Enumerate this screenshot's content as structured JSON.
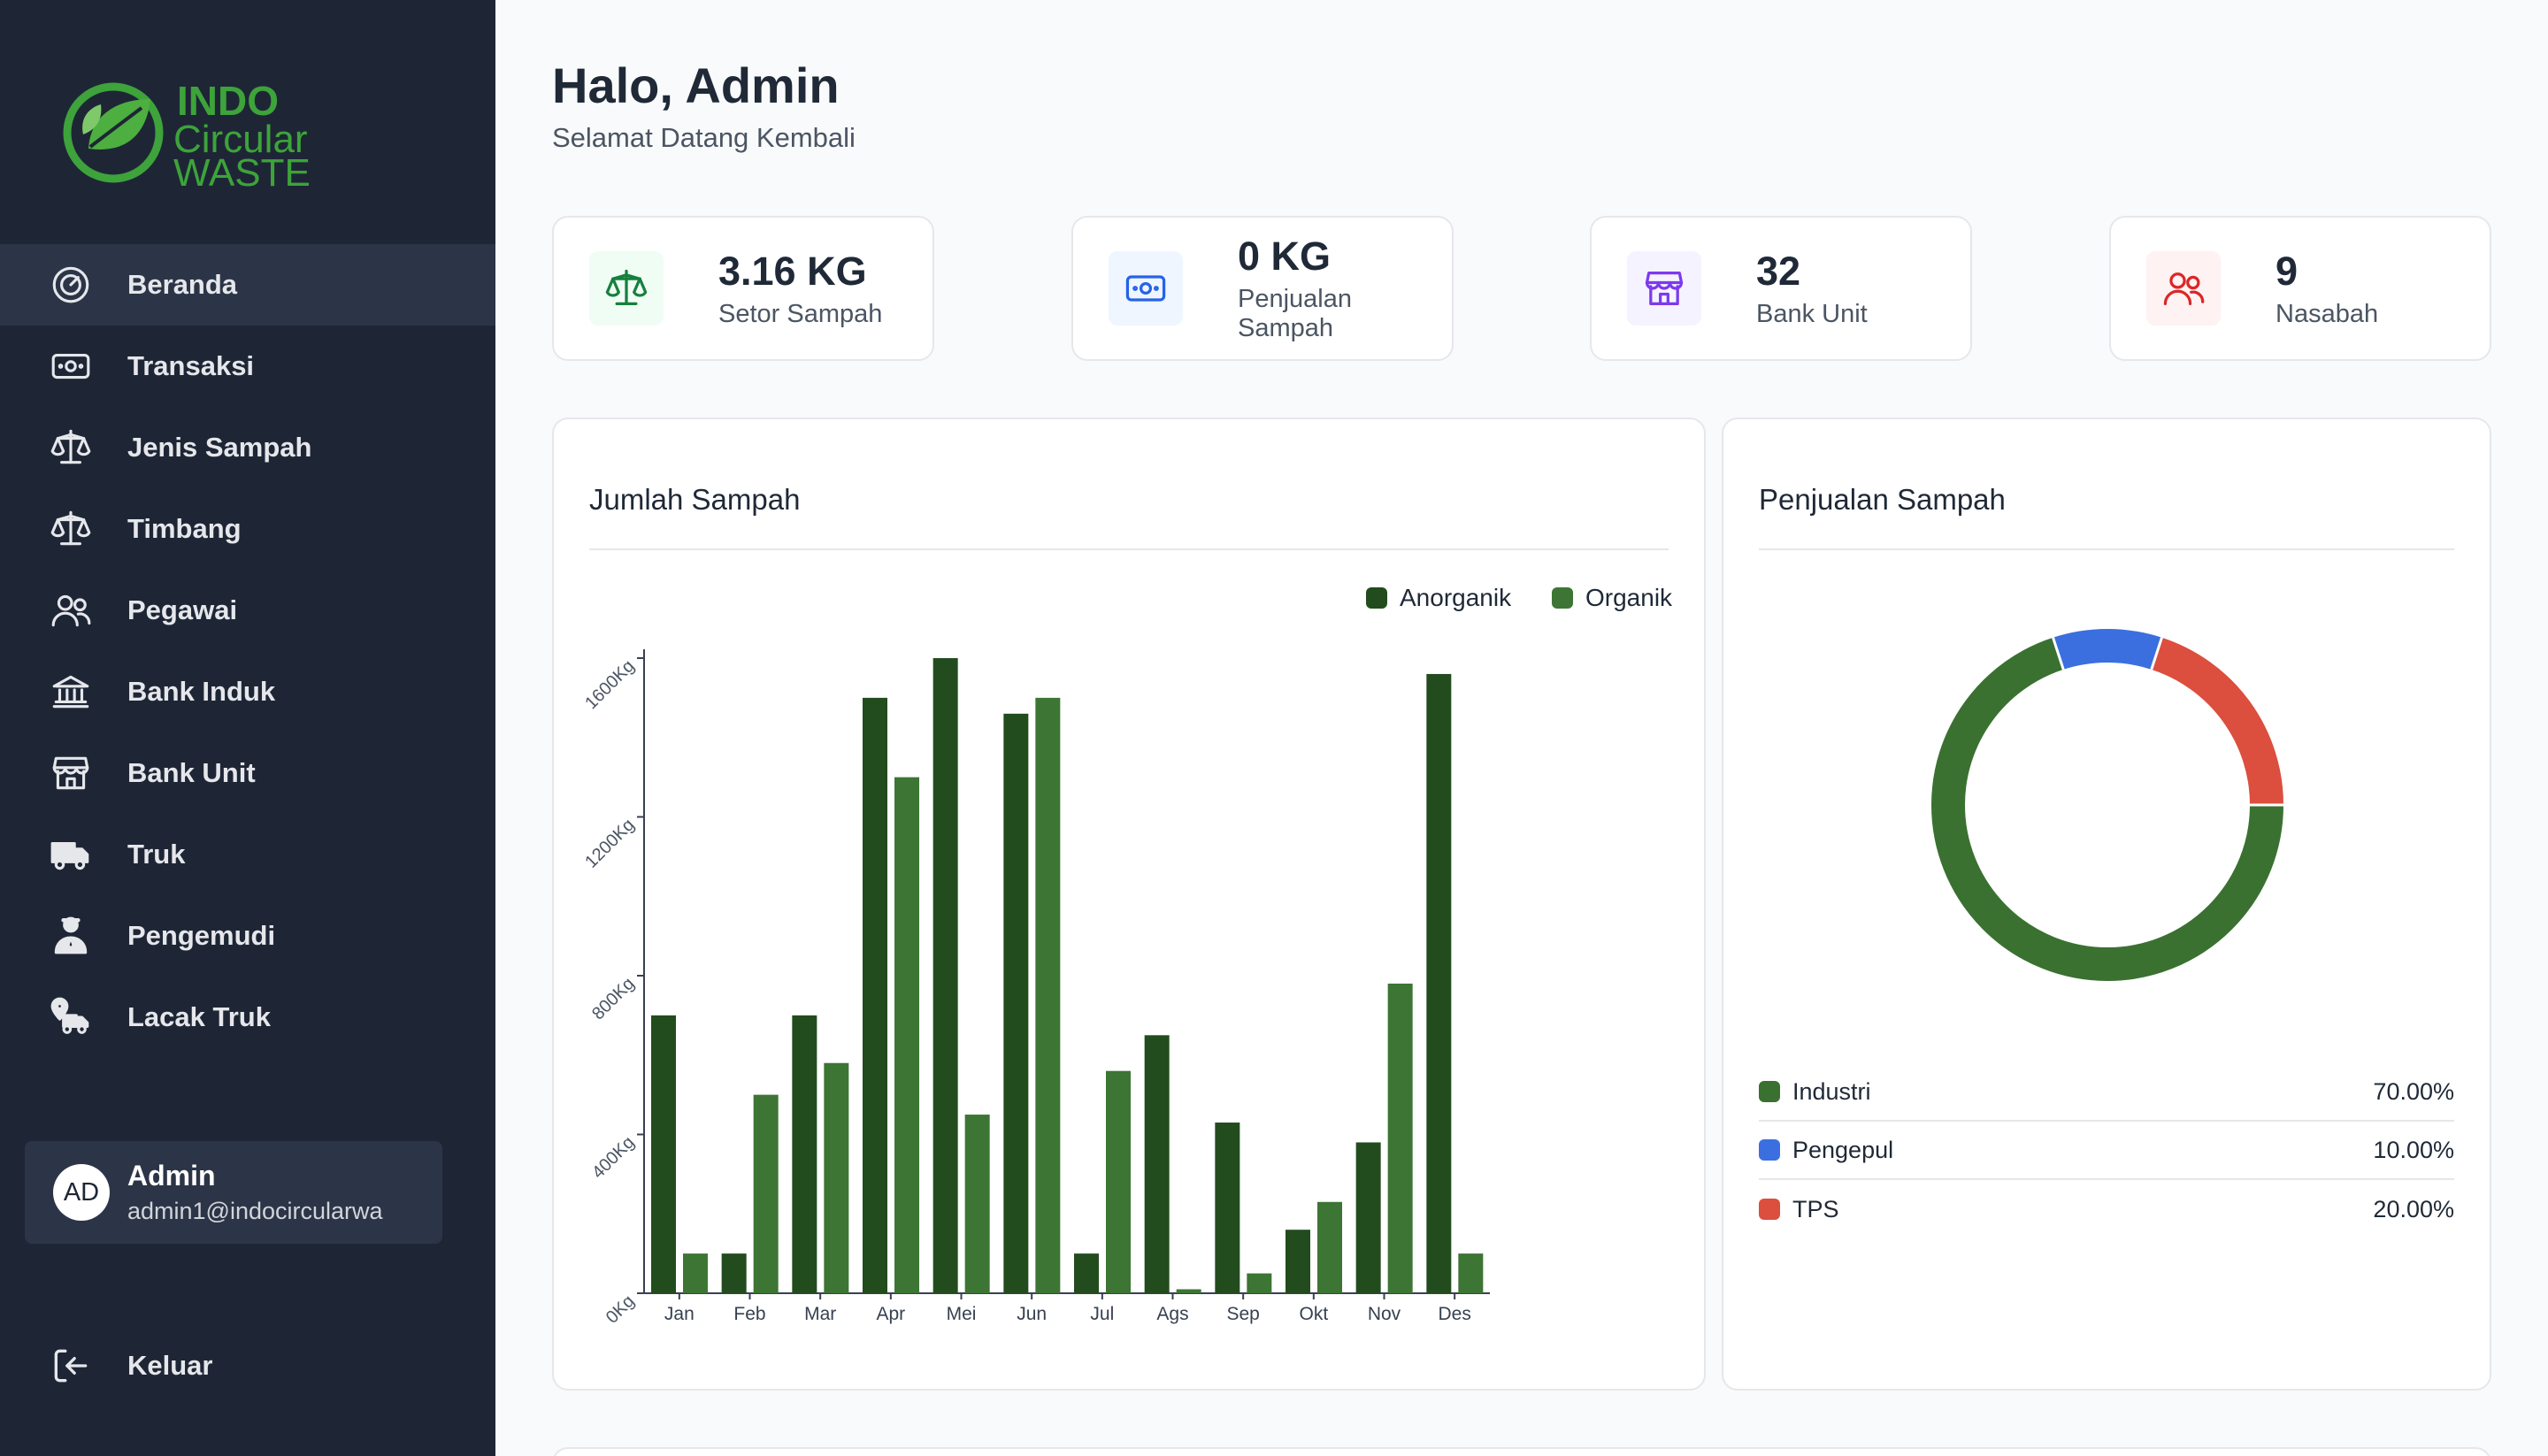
{
  "brand": {
    "line1": "INDO",
    "line2": "Circular",
    "line3": "WASTE"
  },
  "nav": [
    {
      "label": "Beranda",
      "icon": "dashboard-icon",
      "active": true
    },
    {
      "label": "Transaksi",
      "icon": "money-icon"
    },
    {
      "label": "Jenis Sampah",
      "icon": "scale-icon"
    },
    {
      "label": "Timbang",
      "icon": "scale-icon"
    },
    {
      "label": "Pegawai",
      "icon": "users-icon"
    },
    {
      "label": "Bank Induk",
      "icon": "bank-icon"
    },
    {
      "label": "Bank Unit",
      "icon": "store-icon"
    },
    {
      "label": "Truk",
      "icon": "truck-icon"
    },
    {
      "label": "Pengemudi",
      "icon": "driver-icon"
    },
    {
      "label": "Lacak Truk",
      "icon": "truck-location-icon"
    }
  ],
  "profile": {
    "initials": "AD",
    "name": "Admin",
    "email": "admin1@indocircularwa"
  },
  "logout_label": "Keluar",
  "greeting": {
    "title": "Halo, Admin",
    "subtitle": "Selamat Datang Kembali"
  },
  "stats": [
    {
      "value": "3.16 KG",
      "label": "Setor Sampah",
      "icon": "scale-icon",
      "color": "#15803d",
      "bg": "#f0fdf4"
    },
    {
      "value": "0 KG",
      "label": "Penjualan Sampah",
      "icon": "money-icon",
      "color": "#2563eb",
      "bg": "#eff6ff"
    },
    {
      "value": "32",
      "label": "Bank Unit",
      "icon": "store-icon",
      "color": "#7c3aed",
      "bg": "#f5f3ff"
    },
    {
      "value": "9",
      "label": "Nasabah",
      "icon": "users-icon",
      "color": "#dc2626",
      "bg": "#fef2f2"
    }
  ],
  "bar_card": {
    "title": "Jumlah Sampah"
  },
  "pie_card": {
    "title": "Penjualan Sampah"
  },
  "chart_data": [
    {
      "type": "bar",
      "title": "Jumlah Sampah",
      "categories": [
        "Jan",
        "Feb",
        "Mar",
        "Apr",
        "Mei",
        "Jun",
        "Jul",
        "Ags",
        "Sep",
        "Okt",
        "Nov",
        "Des"
      ],
      "series": [
        {
          "name": "Anorganik",
          "color": "#224c1d",
          "values": [
            700,
            100,
            700,
            1500,
            1600,
            1460,
            100,
            650,
            430,
            160,
            380,
            1560
          ]
        },
        {
          "name": "Organik",
          "color": "#3d7534",
          "values": [
            100,
            500,
            580,
            1300,
            450,
            1500,
            560,
            10,
            50,
            230,
            780,
            100
          ]
        }
      ],
      "y_ticks": [
        "0Kg",
        "400Kg",
        "800Kg",
        "1200Kg",
        "1600Kg"
      ],
      "ylim": [
        0,
        1600
      ],
      "legend": "top-right"
    },
    {
      "type": "pie",
      "title": "Penjualan Sampah",
      "slices": [
        {
          "name": "Industri",
          "value": 70,
          "label": "70.00%",
          "color": "#3a7131"
        },
        {
          "name": "Pengepul",
          "value": 10,
          "label": "10.00%",
          "color": "#3b6fe0"
        },
        {
          "name": "TPS",
          "value": 20,
          "label": "20.00%",
          "color": "#dc4e3e"
        }
      ]
    }
  ]
}
